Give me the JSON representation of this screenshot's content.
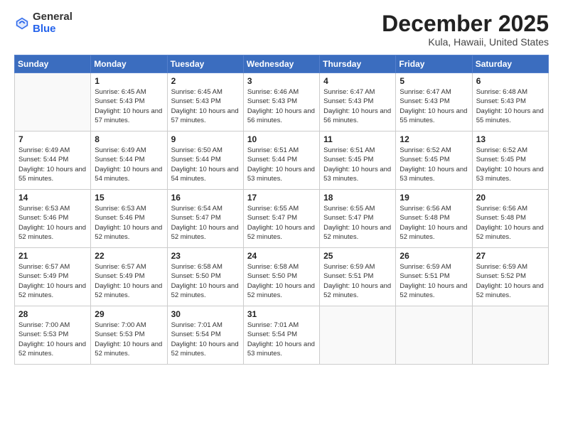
{
  "logo": {
    "general": "General",
    "blue": "Blue"
  },
  "title": "December 2025",
  "subtitle": "Kula, Hawaii, United States",
  "days_of_week": [
    "Sunday",
    "Monday",
    "Tuesday",
    "Wednesday",
    "Thursday",
    "Friday",
    "Saturday"
  ],
  "weeks": [
    [
      {
        "day": "",
        "info": ""
      },
      {
        "day": "1",
        "info": "Sunrise: 6:45 AM\nSunset: 5:43 PM\nDaylight: 10 hours\nand 57 minutes."
      },
      {
        "day": "2",
        "info": "Sunrise: 6:45 AM\nSunset: 5:43 PM\nDaylight: 10 hours\nand 57 minutes."
      },
      {
        "day": "3",
        "info": "Sunrise: 6:46 AM\nSunset: 5:43 PM\nDaylight: 10 hours\nand 56 minutes."
      },
      {
        "day": "4",
        "info": "Sunrise: 6:47 AM\nSunset: 5:43 PM\nDaylight: 10 hours\nand 56 minutes."
      },
      {
        "day": "5",
        "info": "Sunrise: 6:47 AM\nSunset: 5:43 PM\nDaylight: 10 hours\nand 55 minutes."
      },
      {
        "day": "6",
        "info": "Sunrise: 6:48 AM\nSunset: 5:43 PM\nDaylight: 10 hours\nand 55 minutes."
      }
    ],
    [
      {
        "day": "7",
        "info": "Sunrise: 6:49 AM\nSunset: 5:44 PM\nDaylight: 10 hours\nand 55 minutes."
      },
      {
        "day": "8",
        "info": "Sunrise: 6:49 AM\nSunset: 5:44 PM\nDaylight: 10 hours\nand 54 minutes."
      },
      {
        "day": "9",
        "info": "Sunrise: 6:50 AM\nSunset: 5:44 PM\nDaylight: 10 hours\nand 54 minutes."
      },
      {
        "day": "10",
        "info": "Sunrise: 6:51 AM\nSunset: 5:44 PM\nDaylight: 10 hours\nand 53 minutes."
      },
      {
        "day": "11",
        "info": "Sunrise: 6:51 AM\nSunset: 5:45 PM\nDaylight: 10 hours\nand 53 minutes."
      },
      {
        "day": "12",
        "info": "Sunrise: 6:52 AM\nSunset: 5:45 PM\nDaylight: 10 hours\nand 53 minutes."
      },
      {
        "day": "13",
        "info": "Sunrise: 6:52 AM\nSunset: 5:45 PM\nDaylight: 10 hours\nand 53 minutes."
      }
    ],
    [
      {
        "day": "14",
        "info": "Sunrise: 6:53 AM\nSunset: 5:46 PM\nDaylight: 10 hours\nand 52 minutes."
      },
      {
        "day": "15",
        "info": "Sunrise: 6:53 AM\nSunset: 5:46 PM\nDaylight: 10 hours\nand 52 minutes."
      },
      {
        "day": "16",
        "info": "Sunrise: 6:54 AM\nSunset: 5:47 PM\nDaylight: 10 hours\nand 52 minutes."
      },
      {
        "day": "17",
        "info": "Sunrise: 6:55 AM\nSunset: 5:47 PM\nDaylight: 10 hours\nand 52 minutes."
      },
      {
        "day": "18",
        "info": "Sunrise: 6:55 AM\nSunset: 5:47 PM\nDaylight: 10 hours\nand 52 minutes."
      },
      {
        "day": "19",
        "info": "Sunrise: 6:56 AM\nSunset: 5:48 PM\nDaylight: 10 hours\nand 52 minutes."
      },
      {
        "day": "20",
        "info": "Sunrise: 6:56 AM\nSunset: 5:48 PM\nDaylight: 10 hours\nand 52 minutes."
      }
    ],
    [
      {
        "day": "21",
        "info": "Sunrise: 6:57 AM\nSunset: 5:49 PM\nDaylight: 10 hours\nand 52 minutes."
      },
      {
        "day": "22",
        "info": "Sunrise: 6:57 AM\nSunset: 5:49 PM\nDaylight: 10 hours\nand 52 minutes."
      },
      {
        "day": "23",
        "info": "Sunrise: 6:58 AM\nSunset: 5:50 PM\nDaylight: 10 hours\nand 52 minutes."
      },
      {
        "day": "24",
        "info": "Sunrise: 6:58 AM\nSunset: 5:50 PM\nDaylight: 10 hours\nand 52 minutes."
      },
      {
        "day": "25",
        "info": "Sunrise: 6:59 AM\nSunset: 5:51 PM\nDaylight: 10 hours\nand 52 minutes."
      },
      {
        "day": "26",
        "info": "Sunrise: 6:59 AM\nSunset: 5:51 PM\nDaylight: 10 hours\nand 52 minutes."
      },
      {
        "day": "27",
        "info": "Sunrise: 6:59 AM\nSunset: 5:52 PM\nDaylight: 10 hours\nand 52 minutes."
      }
    ],
    [
      {
        "day": "28",
        "info": "Sunrise: 7:00 AM\nSunset: 5:53 PM\nDaylight: 10 hours\nand 52 minutes."
      },
      {
        "day": "29",
        "info": "Sunrise: 7:00 AM\nSunset: 5:53 PM\nDaylight: 10 hours\nand 52 minutes."
      },
      {
        "day": "30",
        "info": "Sunrise: 7:01 AM\nSunset: 5:54 PM\nDaylight: 10 hours\nand 52 minutes."
      },
      {
        "day": "31",
        "info": "Sunrise: 7:01 AM\nSunset: 5:54 PM\nDaylight: 10 hours\nand 53 minutes."
      },
      {
        "day": "",
        "info": ""
      },
      {
        "day": "",
        "info": ""
      },
      {
        "day": "",
        "info": ""
      }
    ]
  ]
}
